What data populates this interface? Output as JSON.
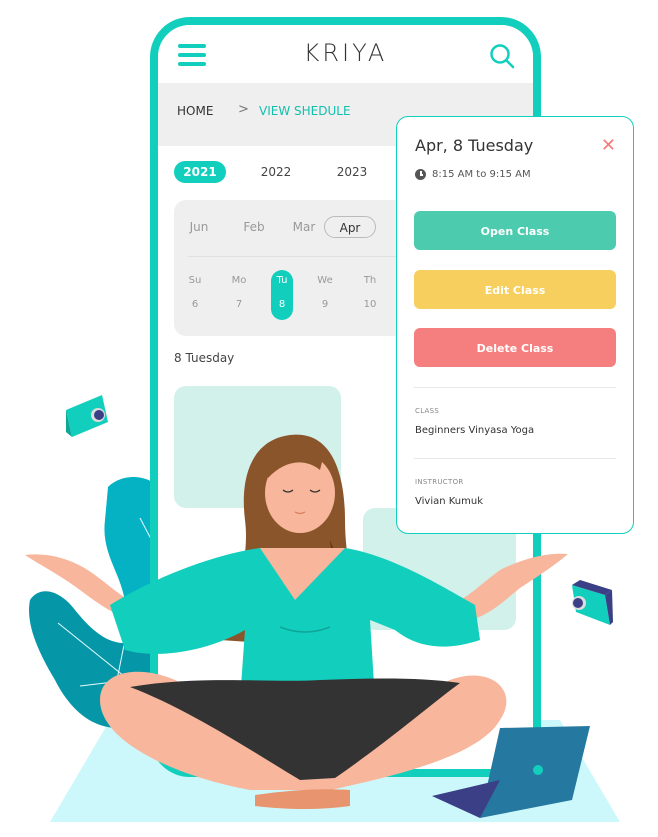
{
  "app": {
    "logo_text": "KRIYA"
  },
  "header": {
    "menu_icon": "hamburger-menu-icon",
    "search_icon": "search-icon"
  },
  "breadcrumb": {
    "home": "HOME",
    "separator": ">",
    "current": "VIEW SHEDULE"
  },
  "years": [
    {
      "label": "2021",
      "active": true
    },
    {
      "label": "2022",
      "active": false
    },
    {
      "label": "2023",
      "active": false
    }
  ],
  "months": [
    {
      "label": "Jun",
      "active": false
    },
    {
      "label": "Feb",
      "active": false
    },
    {
      "label": "Mar",
      "active": false
    },
    {
      "label": "Apr",
      "active": true
    }
  ],
  "days": [
    {
      "name": "Su",
      "date": "6",
      "active": false
    },
    {
      "name": "Mo",
      "date": "7",
      "active": false
    },
    {
      "name": "Tu",
      "date": "8",
      "active": true
    },
    {
      "name": "We",
      "date": "9",
      "active": false
    },
    {
      "name": "Th",
      "date": "10",
      "active": false
    }
  ],
  "selected_date_label": "8 Tuesday",
  "details": {
    "title": "Apr, 8 Tuesday",
    "close_icon": "close-icon",
    "time": "8:15 AM to 9:15 AM",
    "buttons": {
      "open": "Open Class",
      "edit": "Edit Class",
      "delete": "Delete Class"
    },
    "class_label": "CLASS",
    "class_value": "Beginners Vinyasa Yoga",
    "instructor_label": "INSTRUCTOR",
    "instructor_value": "Vivian Kumuk"
  },
  "colors": {
    "accent": "#12cfbd",
    "open": "#4ccbaf",
    "edit": "#f6cf5e",
    "delete": "#f47f7e"
  }
}
